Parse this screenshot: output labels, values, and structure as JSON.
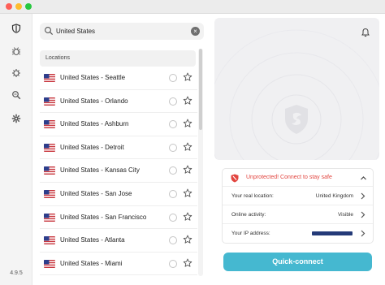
{
  "window": {
    "controls": [
      "close",
      "minimize",
      "zoom"
    ]
  },
  "rail": {
    "items": [
      {
        "icon": "shield-icon",
        "active": true
      },
      {
        "icon": "bug-icon",
        "active": false
      },
      {
        "icon": "gear-outline-icon",
        "active": false
      },
      {
        "icon": "search-zoom-icon",
        "active": false
      },
      {
        "icon": "gear-icon",
        "active": false
      }
    ],
    "version": "4.9.5"
  },
  "search": {
    "value": "United States",
    "placeholder": "",
    "clear_symbol": "×"
  },
  "locations": {
    "header": "Locations",
    "items": [
      {
        "label": "United States - Seattle"
      },
      {
        "label": "United States - Orlando"
      },
      {
        "label": "United States - Ashburn"
      },
      {
        "label": "United States - Detroit"
      },
      {
        "label": "United States - Kansas City"
      },
      {
        "label": "United States - San Jose"
      },
      {
        "label": "United States - San Francisco"
      },
      {
        "label": "United States - Atlanta"
      },
      {
        "label": "United States - Miami"
      }
    ]
  },
  "status": {
    "unprotected": "Unprotected! Connect to stay safe",
    "real_location_label": "Your real location:",
    "real_location_value": "United Kingdom",
    "online_activity_label": "Online activity:",
    "online_activity_value": "Visible",
    "ip_label": "Your IP address:"
  },
  "actions": {
    "quick_connect": "Quick-connect"
  },
  "colors": {
    "accent": "#45b8d0",
    "warning": "#e2453f",
    "ip_redaction": "#243a78"
  }
}
